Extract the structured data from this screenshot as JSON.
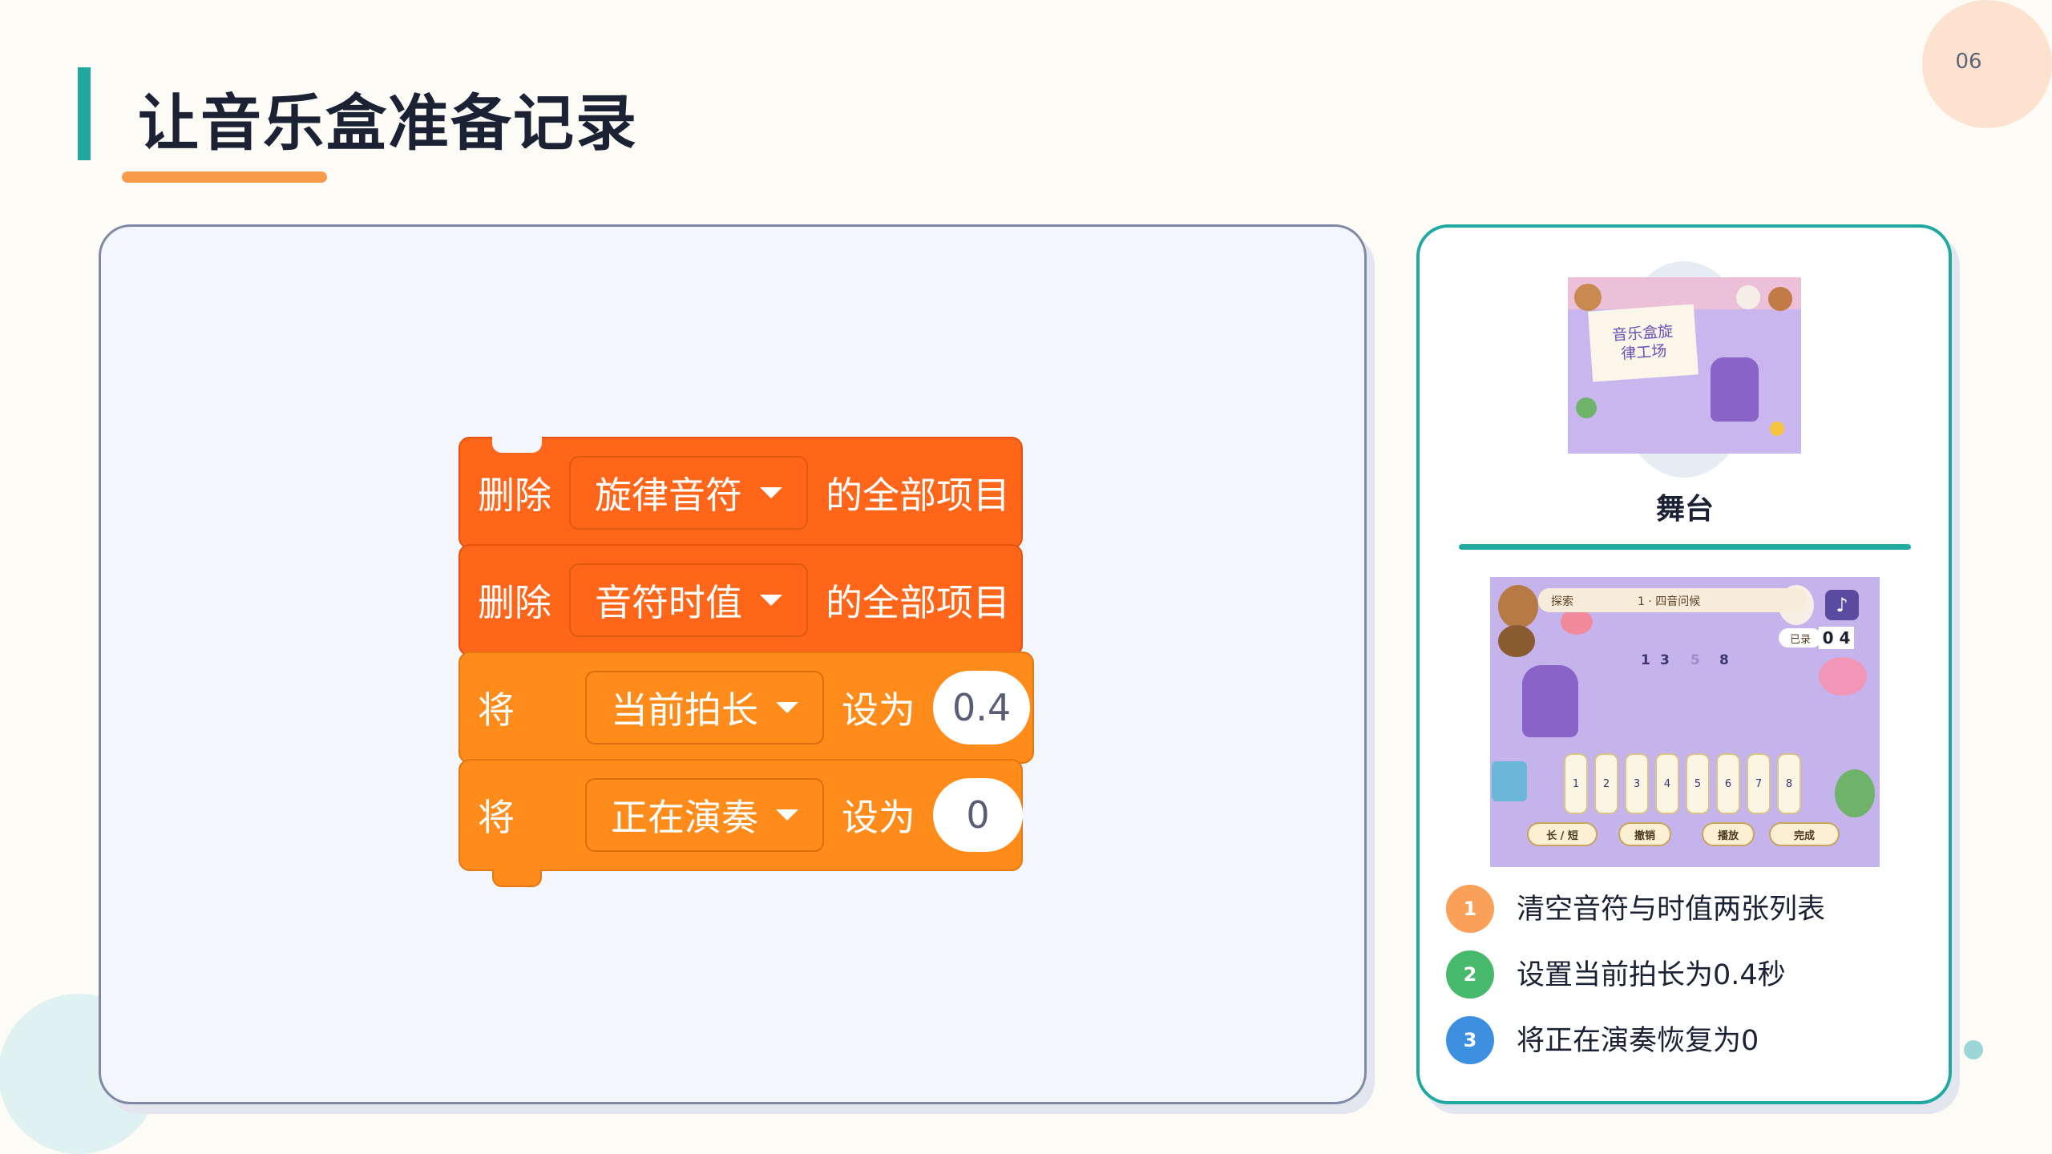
{
  "page_number": "06",
  "title": "让音乐盒准备记录",
  "code_blocks": [
    {
      "prefix": "删除",
      "dropdown": "旋律音符",
      "suffix": "的全部项目",
      "color": "#ff661a"
    },
    {
      "prefix": "删除",
      "dropdown": "音符时值",
      "suffix": "的全部项目",
      "color": "#ff661a"
    },
    {
      "prefix": "将",
      "dropdown": "当前拍长",
      "suffix": "设为",
      "value": "0.4",
      "color": "#ff8c1a"
    },
    {
      "prefix": "将",
      "dropdown": "正在演奏",
      "suffix": "设为",
      "value": "0",
      "color": "#ff8c1a"
    }
  ],
  "stage": {
    "thumbnail_sign": [
      "音乐盒旋",
      "律工场"
    ],
    "label": "舞台"
  },
  "game_screenshot": {
    "topbar_left": "探索",
    "topbar_center": "1 · 四音问候",
    "record_label": "已录",
    "record_count": "0 4",
    "sequence": [
      "1",
      "3",
      "5",
      "8"
    ],
    "keys": [
      "1",
      "2",
      "3",
      "4",
      "5",
      "6",
      "7",
      "8"
    ],
    "buttons": [
      "长 / 短",
      "撤销",
      "播放",
      "完成"
    ],
    "volume_icon": "speaker-icon"
  },
  "steps": [
    {
      "num": "1",
      "text": "清空音符与时值两张列表",
      "color": "#f9a15a"
    },
    {
      "num": "2",
      "text": "设置当前拍长为0.4秒",
      "color": "#48b86c"
    },
    {
      "num": "3",
      "text": "将正在演奏恢复为0",
      "color": "#3d8fe0"
    }
  ],
  "colors": {
    "accent_teal": "#1fa9a0",
    "accent_orange": "#f79a4a",
    "list_block": "#ff661a",
    "variable_block": "#ff8c1a"
  }
}
